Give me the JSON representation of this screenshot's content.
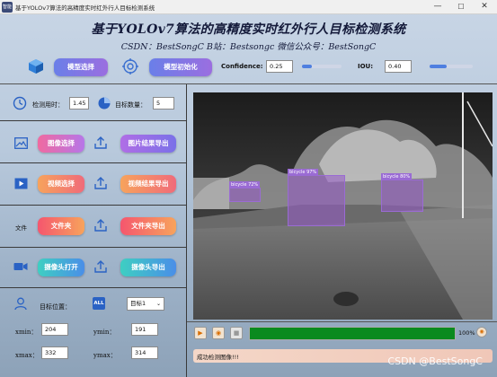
{
  "window": {
    "title": "基于YOLOv7算法的高精度实时红外行人目标检测系统",
    "minimize": "—",
    "maximize": "☐",
    "close": "✕",
    "icon_label": "智能"
  },
  "header": {
    "title": "基于YOLOv7算法的高精度实时红外行人目标检测系统",
    "credits": "CSDN：BestSongC   B站：Bestsongc   微信公众号：BestSongC"
  },
  "toolbar": {
    "model_select": "模型选择",
    "model_init": "模型初始化",
    "confidence_label": "Confidence:",
    "confidence_value": "0.25",
    "confidence_level": 0.25,
    "iou_label": "IOU:",
    "iou_value": "0.40",
    "iou_level": 0.4
  },
  "stats": {
    "time_label": "检测用时：",
    "time_value": "1.45",
    "count_label": "目标数量：",
    "count_value": "5"
  },
  "actions": {
    "image_select": "图像选择",
    "image_export": "图片结果导出",
    "video_select": "视频选择",
    "video_export": "视频结果导出",
    "folder_tag": "文件",
    "folder_select": "文件夹",
    "folder_export": "文件夹导出",
    "camera_open": "摄像头打开",
    "camera_export": "摄像头导出"
  },
  "position": {
    "target_label": "目标位置：",
    "all_icon_text": "ALL",
    "target_select": "目标1",
    "xmin_label": "xmin：",
    "xmin_value": "204",
    "ymin_label": "ymin：",
    "ymin_value": "191",
    "xmax_label": "xmax：",
    "xmax_value": "332",
    "ymax_label": "ymax：",
    "ymax_value": "314"
  },
  "video": {
    "detections": [
      {
        "label": "bicycle 97%"
      },
      {
        "label": "bicycle 80%"
      },
      {
        "label": "bicycle 72%"
      }
    ]
  },
  "playback": {
    "progress_percent": 100,
    "progress_label": "100%"
  },
  "status": {
    "message": "成功检测图像!!!"
  },
  "watermark": "CSDN @BestSongC",
  "colors": {
    "accent_blue": "#4f7fe0",
    "progress_green": "#0a8a1e",
    "title_color": "#141a3a"
  }
}
